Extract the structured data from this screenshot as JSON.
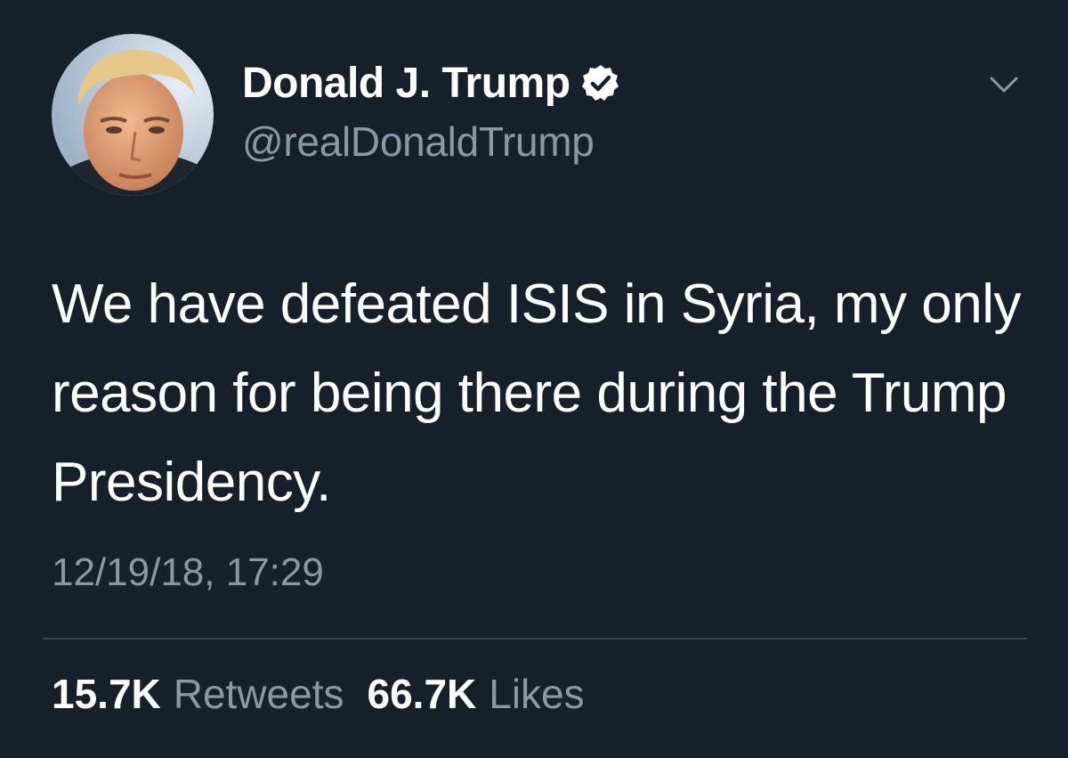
{
  "author": {
    "display_name": "Donald J. Trump",
    "handle": "@realDonaldTrump",
    "verified": true,
    "verified_icon": "verified-badge-icon",
    "avatar_icon": "profile-photo"
  },
  "menu": {
    "icon": "chevron-down-icon"
  },
  "tweet": {
    "text": "We have defeated ISIS in Syria, my only reason for being there during the Trump Presidency.",
    "timestamp": "12/19/18, 17:29"
  },
  "stats": {
    "retweets_count": "15.7K",
    "retweets_label": "Retweets",
    "likes_count": "66.7K",
    "likes_label": "Likes"
  },
  "colors": {
    "background": "#15202b",
    "primary_text": "#ffffff",
    "secondary_text": "#8899a6",
    "divider": "#38444d"
  }
}
